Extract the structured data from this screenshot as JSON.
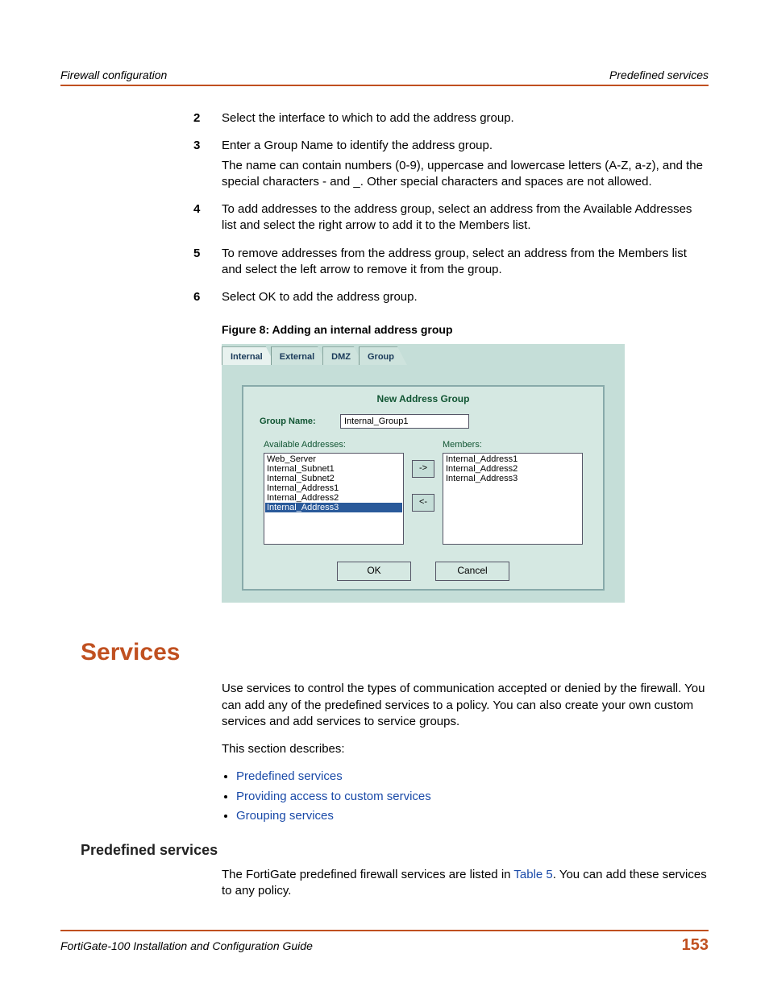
{
  "header": {
    "left": "Firewall configuration",
    "right": "Predefined services"
  },
  "steps": [
    {
      "num": "2",
      "paras": [
        "Select the interface to which to add the address group."
      ]
    },
    {
      "num": "3",
      "paras": [
        "Enter a Group Name to identify the address group.",
        "The name can contain numbers (0-9), uppercase and lowercase letters (A-Z, a-z), and the special characters - and _. Other special characters and spaces are not allowed."
      ]
    },
    {
      "num": "4",
      "paras": [
        "To add addresses to the address group, select an address from the Available Addresses list and select the right arrow to add it to the Members list."
      ]
    },
    {
      "num": "5",
      "paras": [
        "To remove addresses from the address group, select an address from the Members list and select the left arrow to remove it from the group."
      ]
    },
    {
      "num": "6",
      "paras": [
        "Select OK to add the address group."
      ]
    }
  ],
  "figure": {
    "caption": "Figure 8:   Adding an internal address group"
  },
  "ui": {
    "tabs": [
      "Internal",
      "External",
      "DMZ",
      "Group"
    ],
    "active_tab": 0,
    "panel_title": "New Address Group",
    "group_name_label": "Group Name:",
    "group_name_value": "Internal_Group1",
    "available_label": "Available Addresses:",
    "members_label": "Members:",
    "available": [
      "Web_Server",
      "Internal_Subnet1",
      "Internal_Subnet2",
      "Internal_Address1",
      "Internal_Address2",
      "Internal_Address3"
    ],
    "available_selected_index": 5,
    "members": [
      "Internal_Address1",
      "Internal_Address2",
      "Internal_Address3"
    ],
    "arrow_right": "->",
    "arrow_left": "<-",
    "ok": "OK",
    "cancel": "Cancel"
  },
  "services": {
    "heading": "Services",
    "intro": "Use services to control the types of communication accepted or denied by the firewall. You can add any of the predefined services to a policy. You can also create your own custom services and add services to service groups.",
    "describes": "This section describes:",
    "links": [
      "Predefined services",
      "Providing access to custom services",
      "Grouping services"
    ],
    "sub_heading": "Predefined services",
    "sub_text_pre": "The FortiGate predefined firewall services are listed in ",
    "sub_link": "Table 5",
    "sub_text_post": ". You can add these services to any policy."
  },
  "footer": {
    "left": "FortiGate-100 Installation and Configuration Guide",
    "right": "153"
  }
}
